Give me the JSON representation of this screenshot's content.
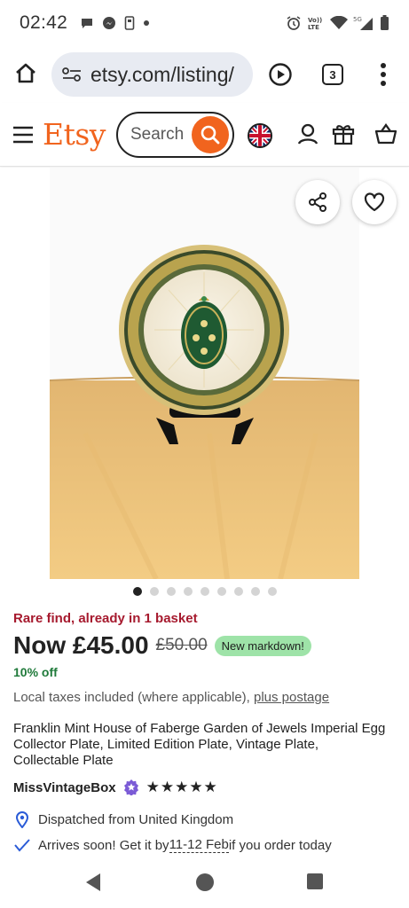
{
  "status_bar": {
    "time": "02:42",
    "icons_left": [
      "chat-bubble-icon",
      "messenger-icon",
      "phone-device-icon",
      "dot-icon"
    ],
    "icons_right": [
      "alarm-icon",
      "volte-icon",
      "wifi-icon",
      "signal-5g-icon",
      "battery-icon"
    ]
  },
  "browser": {
    "url": "etsy.com/listing/",
    "tab_count": "3"
  },
  "header": {
    "logo": "Etsy",
    "search_placeholder": "Search"
  },
  "gallery": {
    "image_count": 9,
    "active_index": 0
  },
  "listing": {
    "scarcity": "Rare find, already in 1 basket",
    "price_now": "Now £45.00",
    "price_old": "£50.00",
    "badge": "New markdown!",
    "discount": "10% off",
    "taxes_text": "Local taxes included (where applicable), ",
    "taxes_link": "plus postage",
    "title": "Franklin Mint House of Faberge Garden of Jewels Imperial Egg Collector Plate, Limited Edition Plate, Vintage Plate, Collectable Plate",
    "shop_name": "MissVintageBox",
    "rating_stars": "★★★★★",
    "dispatch": "Dispatched from United Kingdom",
    "arrival_prefix": "Arrives soon! Get it by ",
    "arrival_dates": "11-12 Feb",
    "arrival_suffix": " if you order today"
  },
  "colors": {
    "etsy_orange": "#f1641e",
    "scarcity_red": "#a61a2e",
    "discount_green": "#1f7a3a",
    "badge_green": "#9ee3a8"
  }
}
